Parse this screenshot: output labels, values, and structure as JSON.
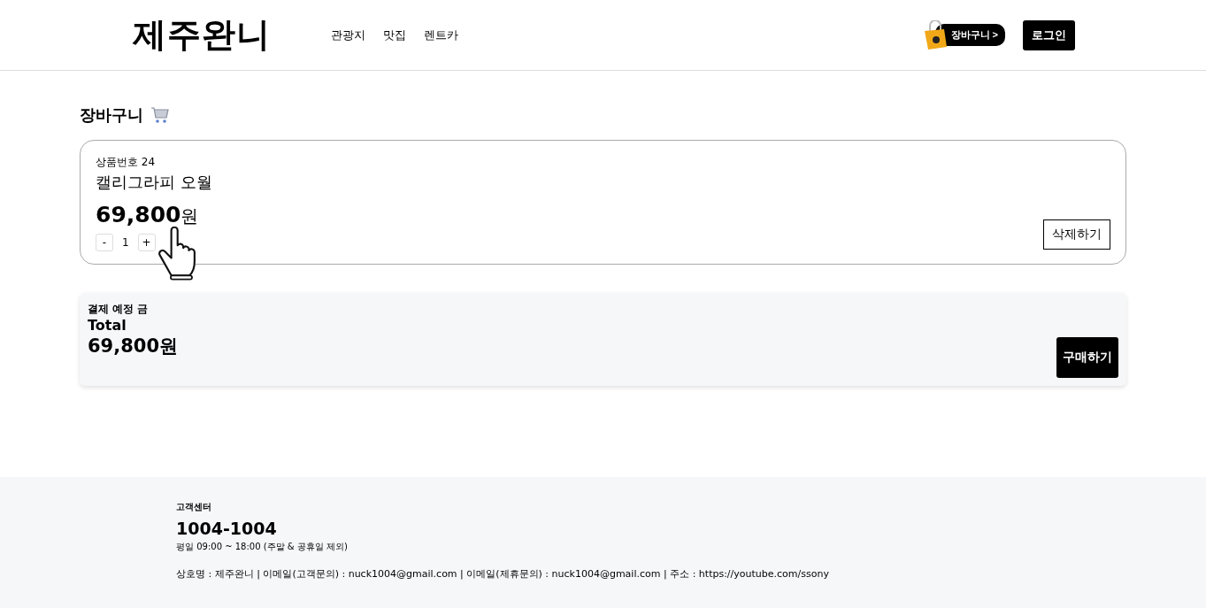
{
  "header": {
    "logo": "제주완니",
    "nav": [
      {
        "label": "관광지"
      },
      {
        "label": "맛집"
      },
      {
        "label": "렌트카"
      }
    ],
    "cart_button": "장바구니 >",
    "login_button": "로그인"
  },
  "page_title": "장바구니",
  "cart_items": [
    {
      "product_number": "상품번호 24",
      "name": "캘리그라피 오월",
      "price": "69,800",
      "currency": "원",
      "minus": "-",
      "quantity": "1",
      "plus": "+",
      "delete_button": "삭제하기"
    }
  ],
  "summary": {
    "label": "결제 예정 금",
    "total_label": "Total",
    "total": "69,800원",
    "buy_button": "구매하기"
  },
  "footer": {
    "title": "고객센터",
    "phone": "1004-1004",
    "hours": "평일 09:00 ~ 18:00 (주말 & 공휴일 제외)",
    "info": "상호명 : 제주완니 | 이메일(고객문의) : nuck1004@gmail.com | 이메일(제휴문의) : nuck1004@gmail.com | 주소 : https://youtube.com/ssony"
  }
}
